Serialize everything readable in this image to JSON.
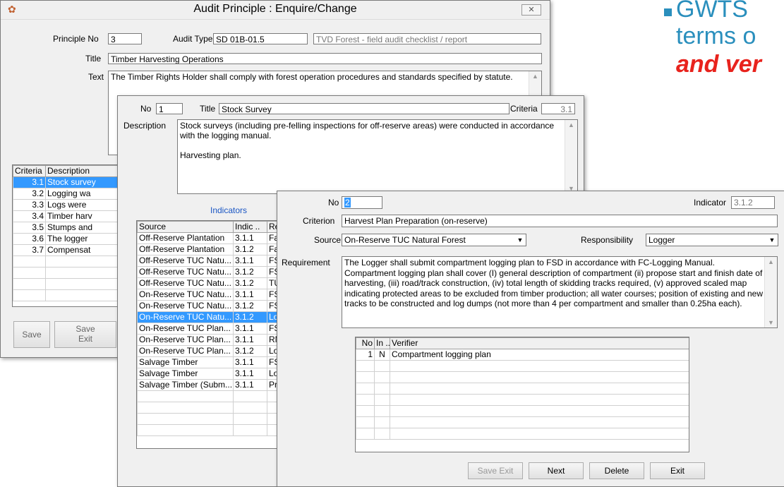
{
  "slide": {
    "bullet_line1": "GWTS",
    "bullet_line2": "terms o",
    "bullet_line3": "and ver",
    "accent_color": "#2a8fbd",
    "emph_color": "#e8231d"
  },
  "win1": {
    "title": "Audit Principle : Enquire/Change",
    "principle_no_label": "Principle No",
    "principle_no": "3",
    "audit_type_label": "Audit Type",
    "audit_type": "SD 01B-01.5",
    "audit_type_desc": "TVD Forest - field audit checklist / report",
    "title_label": "Title",
    "title_value": "Timber Harvesting Operations",
    "text_label": "Text",
    "text_value": "The Timber Rights Holder shall comply with forest operation procedures and standards specified by statute.",
    "grid_headers": [
      "Criteria",
      "Description"
    ],
    "grid_rows": [
      {
        "criteria": "3.1",
        "desc": "Stock survey"
      },
      {
        "criteria": "3.2",
        "desc": "Logging wa"
      },
      {
        "criteria": "3.3",
        "desc": "Logs were"
      },
      {
        "criteria": "3.4",
        "desc": "Timber harv"
      },
      {
        "criteria": "3.5",
        "desc": "Stumps and"
      },
      {
        "criteria": "3.6",
        "desc": "The logger"
      },
      {
        "criteria": "3.7",
        "desc": "Compensat"
      }
    ],
    "btn_save": "Save",
    "btn_save_exit": "Save Exit"
  },
  "win2": {
    "no_label": "No",
    "no_value": "1",
    "title_label": "Title",
    "title_value": "Stock Survey",
    "criteria_label": "Criteria",
    "criteria_value": "3.1",
    "description_label": "Description",
    "description_p1": "Stock surveys (including pre-felling inspections for off-reserve areas) were conducted in accordance with the logging manual.",
    "description_p2": "Harvesting plan.",
    "indicators_label": "Indicators",
    "grid_headers": [
      "Source",
      "Indic ..",
      "Re"
    ],
    "grid_rows": [
      {
        "source": "Off-Reserve Plantation",
        "indic": "3.1.1",
        "re": "Fa"
      },
      {
        "source": "Off-Reserve Plantation",
        "indic": "3.1.2",
        "re": "Fa"
      },
      {
        "source": "Off-Reserve TUC Natu...",
        "indic": "3.1.1",
        "re": "FS"
      },
      {
        "source": "Off-Reserve TUC Natu...",
        "indic": "3.1.2",
        "re": "FS"
      },
      {
        "source": "Off-Reserve TUC Natu...",
        "indic": "3.1.2",
        "re": "TU"
      },
      {
        "source": "On-Reserve TUC Natu...",
        "indic": "3.1.1",
        "re": "FS"
      },
      {
        "source": "On-Reserve TUC Natu...",
        "indic": "3.1.2",
        "re": "FS"
      },
      {
        "source": "On-Reserve TUC Natu...",
        "indic": "3.1.2",
        "re": "Lo"
      },
      {
        "source": "On-Reserve TUC Plan...",
        "indic": "3.1.1",
        "re": "FS"
      },
      {
        "source": "On-Reserve TUC Plan...",
        "indic": "3.1.1",
        "re": "RM"
      },
      {
        "source": "On-Reserve TUC Plan...",
        "indic": "3.1.2",
        "re": "Lo"
      },
      {
        "source": "Salvage Timber",
        "indic": "3.1.1",
        "re": "FS"
      },
      {
        "source": "Salvage Timber",
        "indic": "3.1.1",
        "re": "Lo"
      },
      {
        "source": "Salvage Timber (Subm...",
        "indic": "3.1.1",
        "re": "Pr"
      }
    ]
  },
  "win3": {
    "no_label": "No",
    "no_value": "2",
    "indicator_label": "Indicator",
    "indicator_value": "3.1.2",
    "criterion_label": "Criterion",
    "criterion_value": "Harvest Plan Preparation (on-reserve)",
    "source_label": "Source",
    "source_value": "On-Reserve TUC Natural Forest",
    "responsibility_label": "Responsibility",
    "responsibility_value": "Logger",
    "requirement_label": "Requirement",
    "requirement_value": "The Logger shall submit compartment logging plan to FSD in accordance with FC-Logging Manual. Compartment logging plan shall cover (I) general description of compartment (ii) propose start and finish date of harvesting, (iii) road/track construction, (iv) total length of skidding tracks required, (v) approved scaled map indicating protected areas to be excluded from timber production; all water courses; position of existing and new tracks to be constructed and log dumps (not more than 4 per compartment and smaller than 0.25ha each).",
    "verifier_headers": [
      "No",
      "In ..",
      "Verifier"
    ],
    "verifier_rows": [
      {
        "no": "1",
        "in": "N",
        "verifier": "Compartment logging plan"
      }
    ],
    "btn_save_exit": "Save Exit",
    "btn_next": "Next",
    "btn_delete": "Delete",
    "btn_exit": "Exit"
  }
}
